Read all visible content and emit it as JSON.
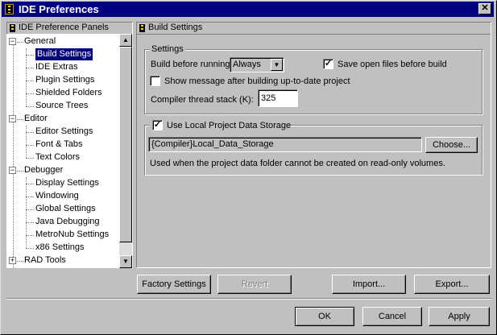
{
  "window": {
    "title": "IDE Preferences",
    "close_glyph": "✕"
  },
  "left_panel": {
    "header": "IDE Preference Panels",
    "tree": [
      {
        "label": "General",
        "level": 0,
        "expanded": true
      },
      {
        "label": "Build Settings",
        "level": 1,
        "selected": true
      },
      {
        "label": "IDE Extras",
        "level": 1
      },
      {
        "label": "Plugin Settings",
        "level": 1
      },
      {
        "label": "Shielded Folders",
        "level": 1
      },
      {
        "label": "Source Trees",
        "level": 1
      },
      {
        "label": "Editor",
        "level": 0,
        "expanded": true
      },
      {
        "label": "Editor Settings",
        "level": 1
      },
      {
        "label": "Font & Tabs",
        "level": 1
      },
      {
        "label": "Text Colors",
        "level": 1
      },
      {
        "label": "Debugger",
        "level": 0,
        "expanded": true
      },
      {
        "label": "Display Settings",
        "level": 1
      },
      {
        "label": "Windowing",
        "level": 1
      },
      {
        "label": "Global Settings",
        "level": 1
      },
      {
        "label": "Java Debugging",
        "level": 1
      },
      {
        "label": "MetroNub Settings",
        "level": 1
      },
      {
        "label": "x86 Settings",
        "level": 1
      },
      {
        "label": "RAD Tools",
        "level": 0,
        "expanded": false
      }
    ],
    "expand_glyph": "−",
    "collapse_glyph": "+",
    "scroll_up_glyph": "▲",
    "scroll_down_glyph": "▼"
  },
  "right_panel": {
    "header": "Build Settings",
    "settings_group": {
      "label": "Settings",
      "build_before_running_label": "Build before running:",
      "build_before_running_value": "Always",
      "dropdown_glyph": "▼",
      "save_open_files_label": "Save open files before build",
      "save_open_files_checked": true,
      "show_message_label": "Show message after building up-to-date project",
      "show_message_checked": false,
      "compiler_thread_stack_label": "Compiler thread stack (K):",
      "compiler_thread_stack_value": "325"
    },
    "local_storage_group": {
      "use_local_label": "Use Local Project Data Storage",
      "use_local_checked": true,
      "path_value": "{Compiler}Local_Data_Storage",
      "choose_button": "Choose...",
      "note": "Used when the project data folder cannot be created on read-only volumes."
    },
    "check_glyph": "✓"
  },
  "buttons": {
    "factory_settings": "Factory Settings",
    "revert": "Revert",
    "import": "Import...",
    "export": "Export...",
    "ok": "OK",
    "cancel": "Cancel",
    "apply": "Apply"
  }
}
